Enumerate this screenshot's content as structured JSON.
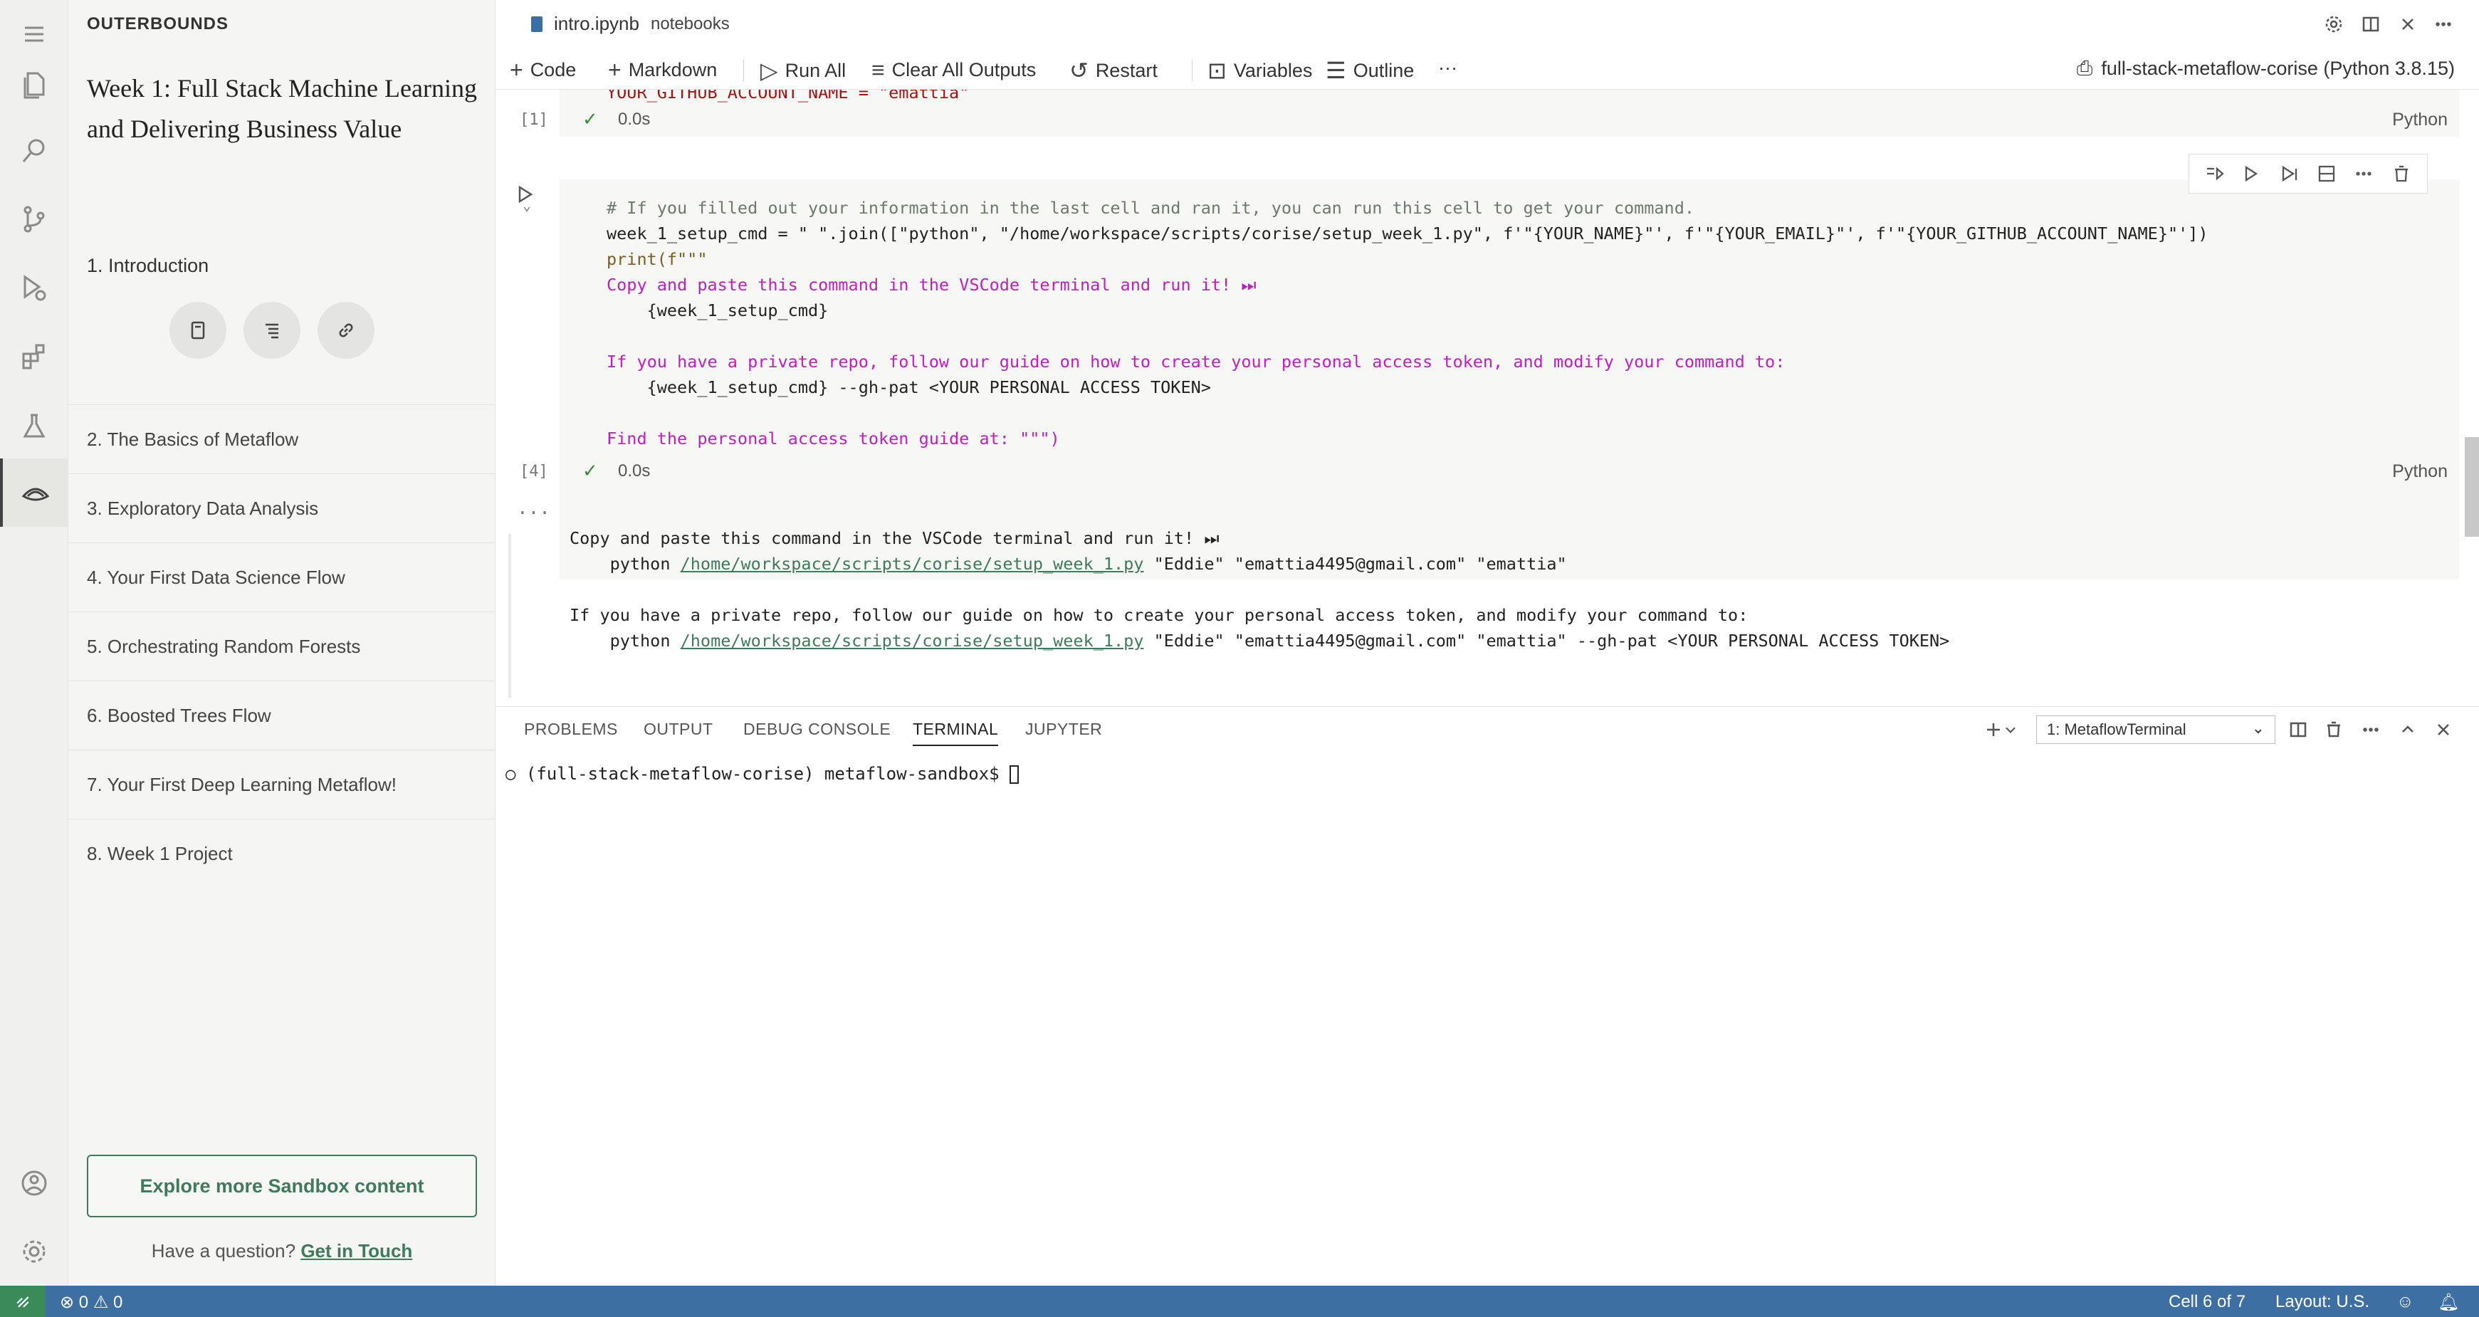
{
  "sidebar": {
    "brand": "OUTERBOUNDS",
    "course_title": "Week 1: Full Stack Machine Learning and Delivering Business Value",
    "active_lesson": "1. Introduction",
    "lessons": [
      "2. The Basics of Metaflow",
      "3. Exploratory Data Analysis",
      "4. Your First Data Science Flow",
      "5. Orchestrating Random Forests",
      "6. Boosted Trees Flow",
      "7. Your First Deep Learning Metaflow!",
      "8. Week 1 Project"
    ],
    "explore_label": "Explore more Sandbox content",
    "question_text": "Have a question?",
    "question_link": "Get in Touch"
  },
  "tab": {
    "file": "intro.ipynb",
    "folder": "notebooks"
  },
  "toolbar": {
    "code": "Code",
    "markdown": "Markdown",
    "run_all": "Run All",
    "clear_outputs": "Clear All Outputs",
    "restart": "Restart",
    "variables": "Variables",
    "outline": "Outline",
    "more": "···",
    "kernel": "full-stack-metaflow-corise (Python 3.8.15)"
  },
  "cells": {
    "prev_partial": "YOUR_GITHUB_ACCOUNT_NAME = \"emattia\"",
    "prev_exec": "[1]",
    "prev_time": "0.0s",
    "lang": "Python",
    "current_exec": "[4]",
    "current_time": "0.0s",
    "code_line1": "# If you filled out your information in the last cell and ran it, you can run this cell to get your command.",
    "code_line2": "week_1_setup_cmd = \" \".join([\"python\", \"/home/workspace/scripts/corise/setup_week_1.py\", f'\"{YOUR_NAME}\"', f'\"{YOUR_EMAIL}\"', f'\"{YOUR_GITHUB_ACCOUNT_NAME}\"'])",
    "code_line3": "print(f\"\"\"",
    "code_line4": "Copy and paste this command in the VSCode terminal and run it! ⏭",
    "code_line5": "    {week_1_setup_cmd}",
    "code_line6": "If you have a private repo, follow our guide on how to create your personal access token, and modify your command to:",
    "code_line7": "    {week_1_setup_cmd} --gh-pat <YOUR PERSONAL ACCESS TOKEN>",
    "code_line8": "Find the personal access token guide at: \"\"\")",
    "out_dots": "···",
    "out_line1": "Copy and paste this command in the VSCode terminal and run it! ⏭",
    "out_cmd_prefix": "    python ",
    "out_path": "/home/workspace/scripts/corise/setup_week_1.py",
    "out_args": " \"Eddie\" \"emattia4495@gmail.com\" \"emattia\"",
    "out_line3": "If you have a private repo, follow our guide on how to create your personal access token, and modify your command to:",
    "out_args2": " \"Eddie\" \"emattia4495@gmail.com\" \"emattia\" --gh-pat <YOUR PERSONAL ACCESS TOKEN>"
  },
  "panel": {
    "tabs": [
      "PROBLEMS",
      "OUTPUT",
      "DEBUG CONSOLE",
      "TERMINAL",
      "JUPYTER"
    ],
    "terminal_name": "1: MetaflowTerminal",
    "prompt": "(full-stack-metaflow-corise) metaflow-sandbox$ "
  },
  "statusbar": {
    "errors": "0",
    "warnings": "0",
    "cell_pos": "Cell 6 of 7",
    "layout": "Layout: U.S."
  },
  "colors": {
    "accent_green": "#3f7a5a",
    "statusbar_blue": "#3e6fa3"
  }
}
